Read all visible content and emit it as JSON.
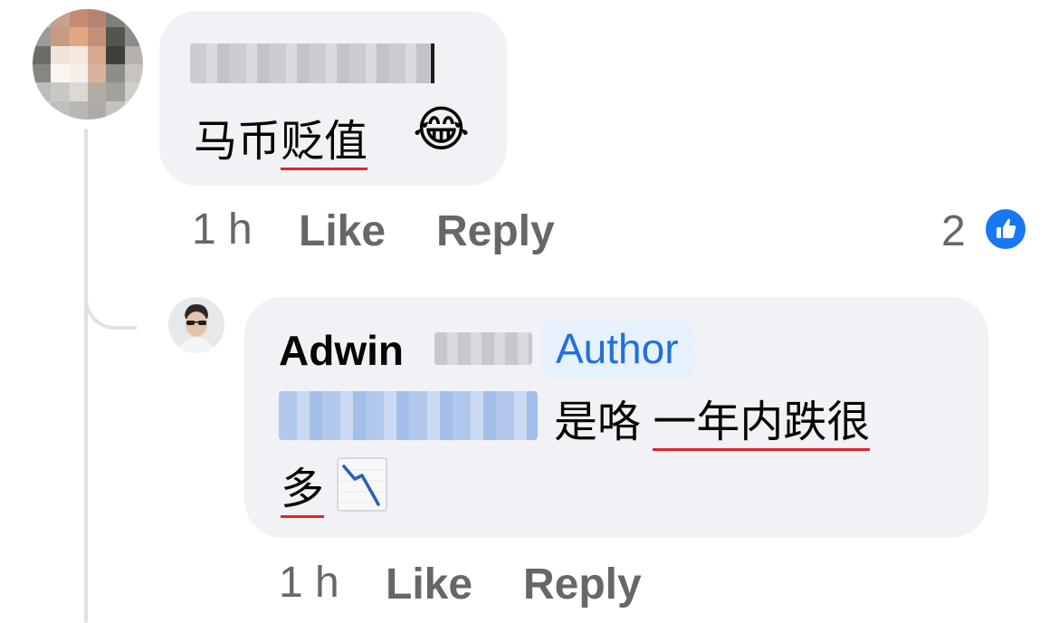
{
  "comment1": {
    "text": "马币",
    "underlined_text": "贬值",
    "emoji": "😂",
    "time": "1 h",
    "like_label": "Like",
    "reply_label": "Reply",
    "reaction_count": "2"
  },
  "comment2": {
    "author": "Adwin",
    "badge": "Author",
    "text_part1": "是咯 ",
    "text_underlined1": "一年内跌很",
    "text_underlined2": "多",
    "time": "1 h",
    "like_label": "Like",
    "reply_label": "Reply"
  },
  "icons": {
    "like_reaction": "like-icon",
    "chart_down": "chart-decreasing-icon"
  },
  "colors": {
    "bubble": "#f0f2f5",
    "author_badge_bg": "#e7f0fd",
    "author_badge_text": "#216fdb",
    "action_text": "#65676b",
    "like_blue": "#1877f2",
    "spellcheck": "#e0242b"
  }
}
